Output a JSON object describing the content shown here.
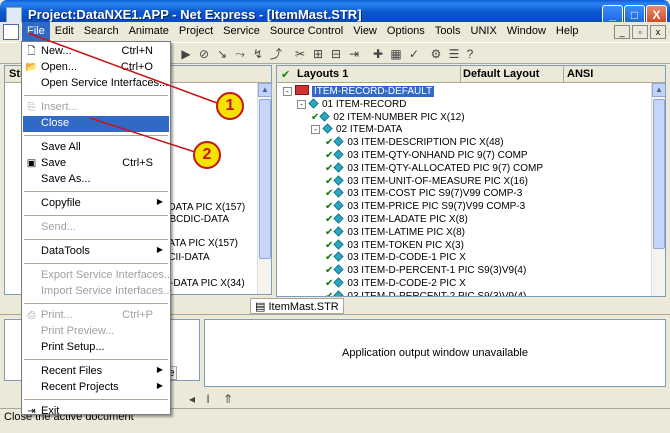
{
  "window": {
    "title": "Project:DataNXE1.APP - Net Express - [ItemMast.STR]",
    "controls": [
      "_",
      "□",
      "X"
    ]
  },
  "menubar": {
    "items": [
      "File",
      "Edit",
      "Search",
      "Animate",
      "Project",
      "Service",
      "Source Control",
      "View",
      "Options",
      "Tools",
      "UNIX",
      "Window",
      "Help"
    ],
    "mdi_controls": [
      "_",
      "▫",
      "x"
    ]
  },
  "left_pane": {
    "header": "Str",
    "fragments": [
      "IC-DATA PIC X(157)",
      "s EBCDIC-DATA",
      "I-DATA PIC X(157)",
      "ASCII-DATA",
      "MB-DATA PIC X(34)"
    ]
  },
  "right_pane": {
    "columns": [
      "Layouts 1",
      "Default Layout",
      "ANSI"
    ],
    "tree": [
      {
        "text": "ITEM-RECORD-DEFAULT",
        "level": 0,
        "toggle": "-",
        "type": "root",
        "selected": true
      },
      {
        "text": "01 ITEM-RECORD",
        "level": 1,
        "toggle": "-",
        "type": "group"
      },
      {
        "text": "02 ITEM-NUMBER PIC X(12)",
        "level": 2,
        "type": "field"
      },
      {
        "text": "02 ITEM-DATA",
        "level": 2,
        "toggle": "-",
        "type": "group"
      },
      {
        "text": "03 ITEM-DESCRIPTION PIC X(48)",
        "level": 3,
        "type": "field"
      },
      {
        "text": "03 ITEM-QTY-ONHAND PIC 9(7) COMP",
        "level": 3,
        "type": "field"
      },
      {
        "text": "03 ITEM-QTY-ALLOCATED PIC 9(7) COMP",
        "level": 3,
        "type": "field"
      },
      {
        "text": "03 ITEM-UNIT-OF-MEASURE PIC X(16)",
        "level": 3,
        "type": "field"
      },
      {
        "text": "03 ITEM-COST PIC S9(7)V99 COMP-3",
        "level": 3,
        "type": "field"
      },
      {
        "text": "03 ITEM-PRICE PIC S9(7)V99 COMP-3",
        "level": 3,
        "type": "field"
      },
      {
        "text": "03 ITEM-LADATE PIC X(8)",
        "level": 3,
        "type": "field"
      },
      {
        "text": "03 ITEM-LATIME PIC X(8)",
        "level": 3,
        "type": "field"
      },
      {
        "text": "03 ITEM-TOKEN PIC X(3)",
        "level": 3,
        "type": "field"
      },
      {
        "text": "03 ITEM-D-CODE-1 PIC X",
        "level": 3,
        "type": "field"
      },
      {
        "text": "03 ITEM-D-PERCENT-1 PIC S9(3)V9(4)",
        "level": 3,
        "type": "field"
      },
      {
        "text": "03 ITEM-D-CODE-2 PIC X",
        "level": 3,
        "type": "field"
      },
      {
        "text": "03 ITEM-D-PERCENT-2 PIC S9(3)V9(4)",
        "level": 3,
        "type": "field"
      }
    ]
  },
  "tabs": [
    "ItemMast.STR"
  ],
  "output_pane": {
    "fragment": "appe"
  },
  "app_output": {
    "message": "Application output window unavailable"
  },
  "statusbar": {
    "text": "Close the active document"
  },
  "file_menu": {
    "items": [
      {
        "label": "New...",
        "shortcut": "Ctrl+N",
        "icon": "new-doc-icon",
        "glyph": "🗋"
      },
      {
        "label": "Open...",
        "shortcut": "Ctrl+O",
        "icon": "open-folder-icon",
        "glyph": "📂"
      },
      {
        "label": "Open Service Interfaces..."
      },
      {
        "sep": true
      },
      {
        "label": "Insert...",
        "disabled": true,
        "icon": "insert-icon",
        "glyph": "⎘"
      },
      {
        "label": "Close",
        "highlighted": true
      },
      {
        "sep": true
      },
      {
        "label": "Save All"
      },
      {
        "label": "Save",
        "shortcut": "Ctrl+S",
        "icon": "floppy-disk-icon",
        "glyph": "▣"
      },
      {
        "label": "Save As..."
      },
      {
        "sep": true
      },
      {
        "label": "Copyfile",
        "submenu": true
      },
      {
        "sep": true
      },
      {
        "label": "Send...",
        "disabled": true
      },
      {
        "sep": true
      },
      {
        "label": "DataTools",
        "submenu": true
      },
      {
        "sep": true
      },
      {
        "label": "Export Service Interfaces...",
        "disabled": true
      },
      {
        "label": "Import Service Interfaces...",
        "disabled": true
      },
      {
        "sep": true
      },
      {
        "label": "Print...",
        "shortcut": "Ctrl+P",
        "disabled": true,
        "icon": "printer-icon",
        "glyph": "⎙"
      },
      {
        "label": "Print Preview...",
        "disabled": true
      },
      {
        "label": "Print Setup..."
      },
      {
        "sep": true
      },
      {
        "label": "Recent Files",
        "submenu": true
      },
      {
        "label": "Recent Projects",
        "submenu": true
      },
      {
        "sep": true
      },
      {
        "label": "Exit",
        "icon": "exit-door-icon",
        "glyph": "⇥"
      }
    ]
  },
  "annotations": {
    "callouts": [
      "1",
      "2"
    ],
    "color": "#c81414",
    "fill": "#f6e400"
  },
  "colors": {
    "titlebar": "#0a58d0",
    "highlight": "#316ac5",
    "face": "#ece9d8"
  }
}
